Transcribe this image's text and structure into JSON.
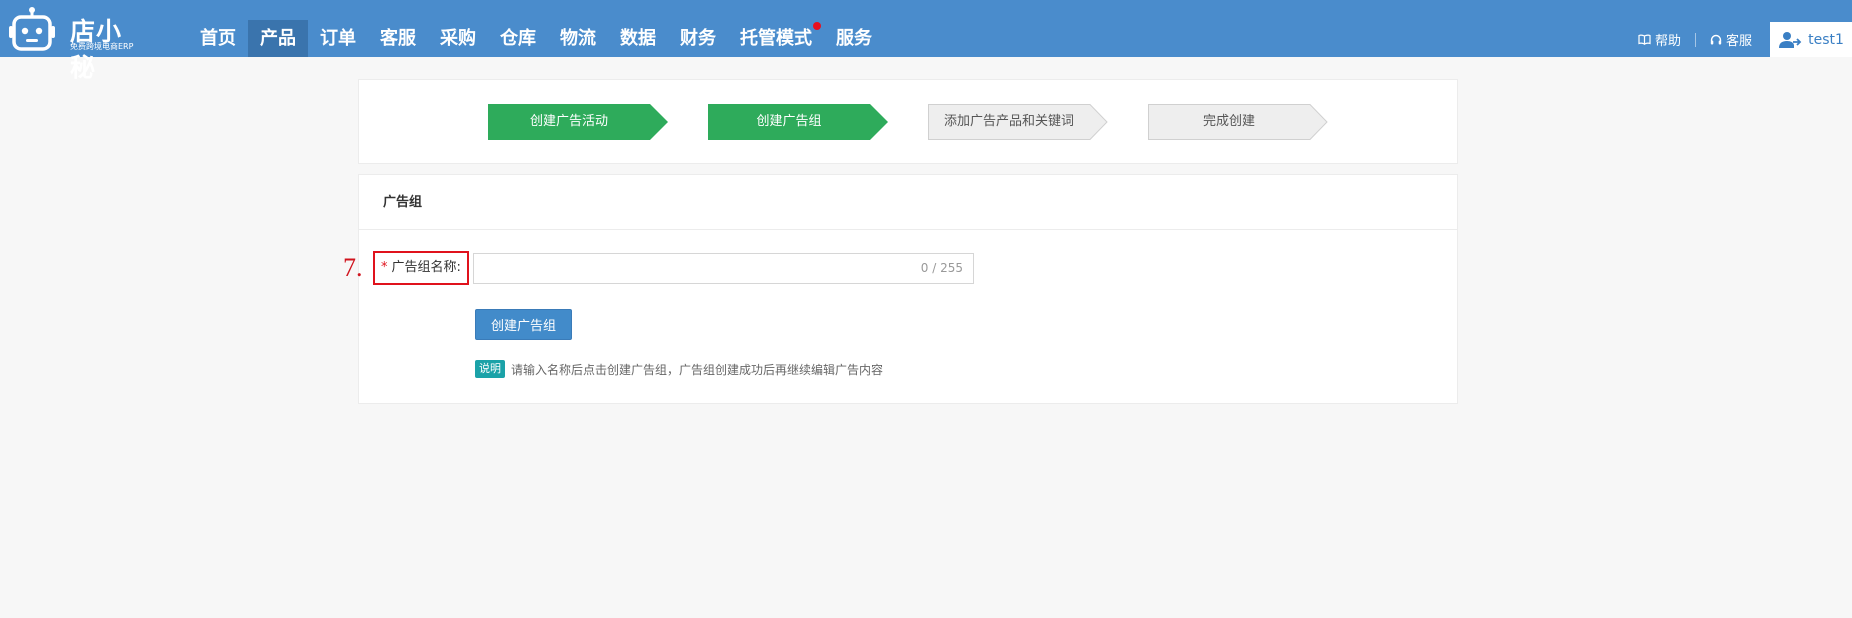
{
  "brand": {
    "name": "店小秘",
    "tagline": "免费跨境电商ERP"
  },
  "nav": [
    {
      "label": "首页"
    },
    {
      "label": "产品",
      "active": true
    },
    {
      "label": "订单"
    },
    {
      "label": "客服"
    },
    {
      "label": "采购"
    },
    {
      "label": "仓库"
    },
    {
      "label": "物流"
    },
    {
      "label": "数据"
    },
    {
      "label": "财务"
    },
    {
      "label": "托管模式",
      "dot": true
    },
    {
      "label": "服务"
    }
  ],
  "header_right": {
    "help_label": "帮助",
    "service_label": "客服",
    "username": "test1"
  },
  "steps": [
    {
      "label": "创建广告活动",
      "state": "done"
    },
    {
      "label": "创建广告组",
      "state": "done"
    },
    {
      "label": "添加广告产品和关键词",
      "state": "pending"
    },
    {
      "label": "完成创建",
      "state": "pending"
    }
  ],
  "form": {
    "section_title": "广告组",
    "required_mark": "*",
    "field_label": "广告组名称:",
    "field_value": "",
    "counter": "0 / 255",
    "submit_label": "创建广告组",
    "note_badge": "说明",
    "note_text": "请输入名称后点击创建广告组，广告组创建成功后再继续编辑广告内容"
  },
  "annotation": "7.",
  "colors": {
    "topbar": "#4a8ccc",
    "nav_active": "#3a74ad",
    "step_done": "#2eab5b",
    "step_pending": "#eeeeee",
    "highlight_box": "#e0121c",
    "primary_button": "#428bca"
  }
}
